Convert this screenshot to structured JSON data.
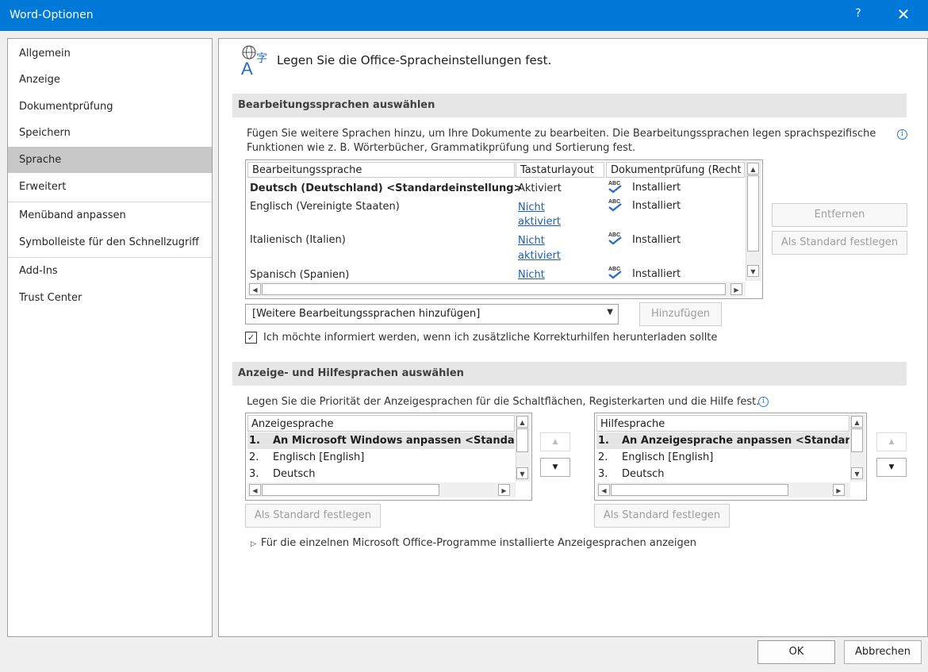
{
  "window": {
    "title": "Word-Optionen",
    "help_label": "?",
    "close_label": "✕"
  },
  "sidebar": {
    "items": [
      {
        "label": "Allgemein"
      },
      {
        "label": "Anzeige"
      },
      {
        "label": "Dokumentprüfung"
      },
      {
        "label": "Speichern"
      },
      {
        "label": "Sprache",
        "selected": true
      },
      {
        "label": "Erweitert"
      },
      {
        "label": "Menüband anpassen"
      },
      {
        "label": "Symbolleiste für den Schnellzugriff"
      },
      {
        "label": "Add-Ins"
      },
      {
        "label": "Trust Center"
      }
    ]
  },
  "page": {
    "title": "Legen Sie die Office-Spracheinstellungen fest.",
    "icon": "language-icon"
  },
  "editing": {
    "header": "Bearbeitungssprachen auswählen",
    "description_line1": "Fügen Sie weitere Sprachen hinzu, um Ihre Dokumente zu bearbeiten. Die Bearbeitungssprachen legen sprachspezifische",
    "description_line2": "Funktionen wie z. B. Wörterbücher, Grammatikprüfung und Sortierung fest.",
    "columns": [
      "Bearbeitungssprache",
      "Tastaturlayout",
      "Dokumentprüfung (Recht"
    ],
    "rows": [
      {
        "language": "Deutsch (Deutschland) <Standardeinstellung>",
        "keyboard": "Aktiviert",
        "keyboard2": "",
        "proofing": "Installiert",
        "bold": true
      },
      {
        "language": "Englisch (Vereinigte Staaten)",
        "keyboard": "Nicht",
        "keyboard2": "aktiviert",
        "proofing": "Installiert"
      },
      {
        "language": "Italienisch (Italien)",
        "keyboard": "Nicht",
        "keyboard2": "aktiviert",
        "proofing": "Installiert"
      },
      {
        "language": "Spanisch (Spanien)",
        "keyboard": "Nicht",
        "keyboard2": "",
        "proofing": "Installiert"
      }
    ],
    "remove_button": "Entfernen",
    "set_default_button": "Als Standard festlegen",
    "add_dropdown_value": "[Weitere Bearbeitungssprachen hinzufügen]",
    "add_button": "Hinzufügen",
    "notify_checkbox_label": "Ich möchte informiert werden, wenn ich zusätzliche Korrekturhilfen herunterladen sollte",
    "notify_checked": true
  },
  "display": {
    "header": "Anzeige- und Hilfesprachen auswählen",
    "description": "Legen Sie die Priorität der Anzeigesprachen für die Schaltflächen, Registerkarten und die Hilfe fest.",
    "display_list": {
      "header": "Anzeigesprache",
      "items": [
        {
          "num": "1.",
          "label": "An Microsoft Windows anpassen <Standarde"
        },
        {
          "num": "2.",
          "label": "Englisch [English]"
        },
        {
          "num": "3.",
          "label": "Deutsch"
        }
      ]
    },
    "help_list": {
      "header": "Hilfesprache",
      "items": [
        {
          "num": "1.",
          "label": "An Anzeigesprache anpassen <Standardei"
        },
        {
          "num": "2.",
          "label": "Englisch [English]"
        },
        {
          "num": "3.",
          "label": "Deutsch"
        }
      ]
    },
    "set_default_display": "Als Standard festlegen",
    "set_default_help": "Als Standard festlegen",
    "expander": "Für die einzelnen Microsoft Office-Programme installierte Anzeigesprachen anzeigen"
  },
  "footer": {
    "ok": "OK",
    "cancel": "Abbrechen"
  }
}
